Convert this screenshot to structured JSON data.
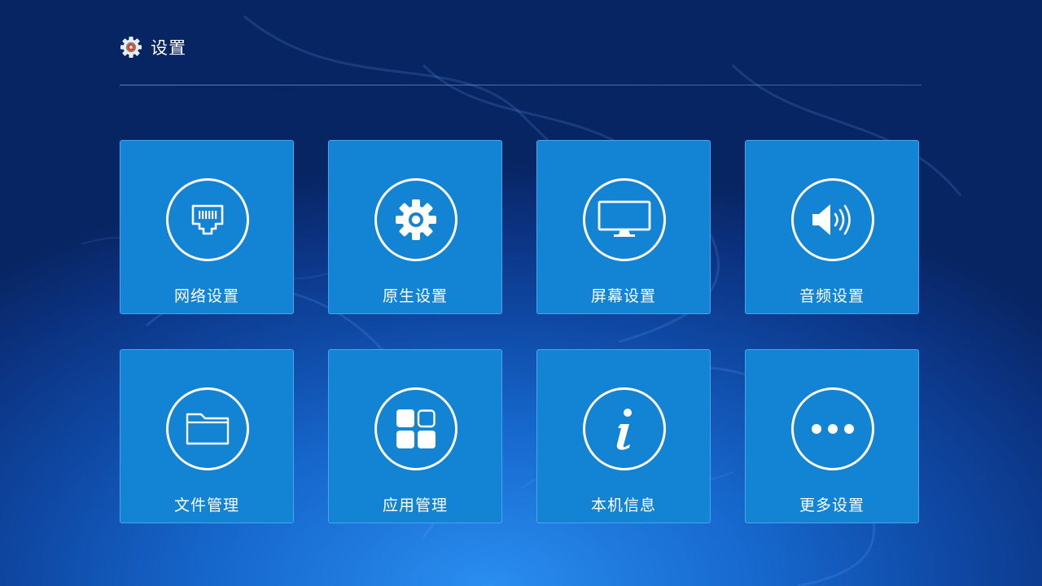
{
  "header": {
    "title": "设置",
    "icon": "gear-icon"
  },
  "tiles": [
    {
      "label": "网络设置",
      "icon": "ethernet-port-icon"
    },
    {
      "label": "原生设置",
      "icon": "gear-icon"
    },
    {
      "label": "屏幕设置",
      "icon": "monitor-icon"
    },
    {
      "label": "音频设置",
      "icon": "speaker-icon"
    },
    {
      "label": "文件管理",
      "icon": "folder-icon"
    },
    {
      "label": "应用管理",
      "icon": "apps-grid-icon"
    },
    {
      "label": "本机信息",
      "icon": "info-icon"
    },
    {
      "label": "更多设置",
      "icon": "more-dots-icon"
    }
  ],
  "colors": {
    "tile": "#1383d4",
    "background_dark": "#082563",
    "background_light": "#2a8ef0",
    "text": "#ffffff",
    "header_icon_accent": "#e0451b"
  }
}
